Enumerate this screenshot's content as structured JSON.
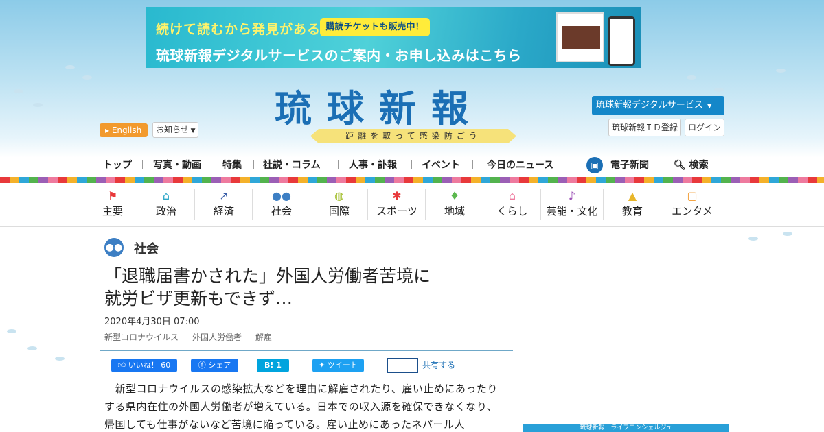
{
  "banner": {
    "line1": "続けて読むから発見がある",
    "ticket": "購読チケットも販売中！",
    "line2": "琉球新報デジタルサービスのご案内・お申し込みはこちら"
  },
  "header": {
    "english_label": "English",
    "news_label": "お知らせ",
    "logo": "琉球新報",
    "tagline": "距離を取って感染防ごう",
    "digital_label": "琉球新報デジタルサービス",
    "register_label": "琉球新報ＩＤ登録",
    "login_label": "ログイン"
  },
  "mainnav": [
    "トップ",
    "写真・動画",
    "特集",
    "社説・コラム",
    "人事・訃報",
    "イベント",
    "今日のニュース",
    "電子新聞",
    "検索"
  ],
  "categories": [
    {
      "label": "主要",
      "icon": "flag-icon",
      "color": "#e8393b"
    },
    {
      "label": "政治",
      "icon": "building-icon",
      "color": "#2fa7c8"
    },
    {
      "label": "経済",
      "icon": "chart-icon",
      "color": "#3a5fa8"
    },
    {
      "label": "社会",
      "icon": "people-icon",
      "color": "#3d7fc4"
    },
    {
      "label": "国際",
      "icon": "globe-icon",
      "color": "#a8c23a"
    },
    {
      "label": "スポーツ",
      "icon": "runner-icon",
      "color": "#e8393b"
    },
    {
      "label": "地域",
      "icon": "pin-icon",
      "color": "#5bb84e"
    },
    {
      "label": "くらし",
      "icon": "house-icon",
      "color": "#ee7a9e"
    },
    {
      "label": "芸能・文化",
      "icon": "music-icon",
      "color": "#9b4fb5"
    },
    {
      "label": "教育",
      "icon": "cap-icon",
      "color": "#e8b62a"
    },
    {
      "label": "エンタメ",
      "icon": "tv-icon",
      "color": "#f29a2e"
    }
  ],
  "article": {
    "section": "社会",
    "title_line1": "「退職届書かされた」外国人労働者苦境に",
    "title_line2": "就労ビザ更新もできず…",
    "date": "2020年4月30日 07:00",
    "tags": [
      "新型コロナウイルス",
      "外国人労働者",
      "解雇"
    ],
    "like_label": "いいね！ 60",
    "fb_share_label": "シェア",
    "hatena_label": "B! 1",
    "tweet_label": "ツイート",
    "share_label": "共有する",
    "body": "　新型コロナウイルスの感染拡大などを理由に解雇されたり、雇い止めにあったりする県内在住の外国人労働者が増えている。日本での収入源を確保できなくなり、帰国しても仕事がないなど苦境に陥っている。雇い止めにあったネパール人"
  },
  "sidebar": {
    "ad_label": "琉球新報　ライフコンシェルジュ"
  }
}
